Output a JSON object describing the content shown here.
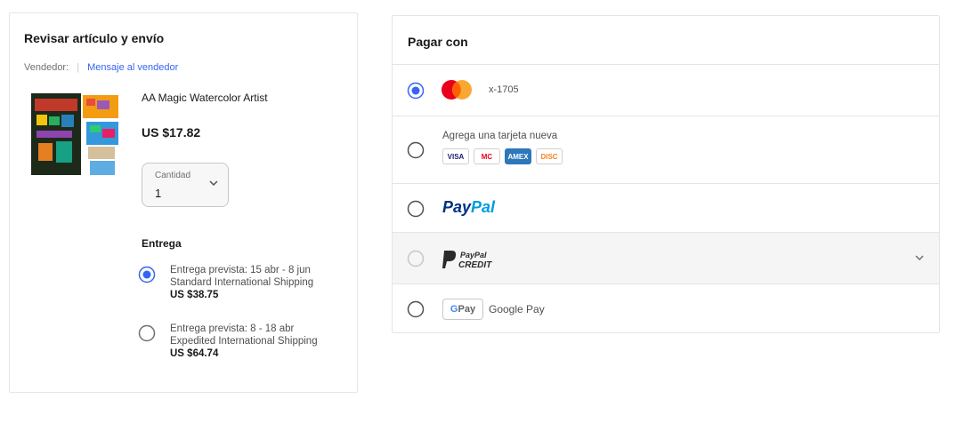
{
  "review": {
    "title": "Revisar artículo y envío",
    "seller_name": "Vendedor: ",
    "seller_separator": "|",
    "message_link": "Mensaje al vendedor",
    "product_name": "AA Magic Watercolor Artist",
    "product_price": "US $17.82",
    "quantity_label": "Cantidad",
    "quantity_value": "1",
    "delivery_title": "Entrega",
    "shipping_options": [
      {
        "line1": "Entrega prevista: 15 abr - 8 jun",
        "line2": "Standard International Shipping",
        "price": "US $38.75",
        "selected": true
      },
      {
        "line1": "Entrega prevista: 8 - 18 abr",
        "line2": "Expedited International Shipping",
        "price": "US $64.74",
        "selected": false
      }
    ]
  },
  "payment": {
    "title": "Pagar con",
    "saved_card": {
      "digits": "x-1705",
      "selected": true
    },
    "add_card": {
      "label": "Agrega una tarjeta nueva",
      "logos": [
        "VISA",
        "MC",
        "AMEX",
        "DISC"
      ]
    },
    "paypal": {
      "part1": "Pay",
      "part2": "Pal"
    },
    "paypal_credit": {
      "line1": "PayPal",
      "line2": "CREDIT"
    },
    "google_pay": {
      "badge_g": "G",
      "badge_text": " Pay",
      "label": "Google Pay"
    }
  },
  "colors": {
    "accent": "#3665f3",
    "border": "#e5e5e5",
    "mastercard_red": "#eb001b",
    "mastercard_yellow": "#f79e1b"
  }
}
